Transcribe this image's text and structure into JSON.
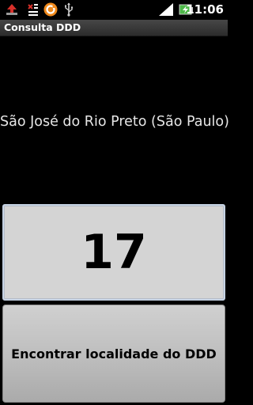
{
  "status_bar": {
    "time": "11:06",
    "icons": [
      "upload-arrow-icon",
      "missed-call-icon",
      "circle-app-icon",
      "usb-icon",
      "signal-icon",
      "battery-charging-icon"
    ]
  },
  "app": {
    "title": "Consulta DDD"
  },
  "location": {
    "text": "São José do Rio Preto (São Paulo)"
  },
  "ddd": {
    "value": "17"
  },
  "actions": {
    "find_label": "Encontrar localidade do DDD"
  },
  "colors": {
    "background": "#000000",
    "field_bg": "#d4d4d4",
    "field_border": "#c6d3e4",
    "button_bg": "#bdbdbd",
    "status_icon_orange": "#f08a1c",
    "status_icon_red": "#d8302a",
    "battery_green": "#4db848"
  }
}
